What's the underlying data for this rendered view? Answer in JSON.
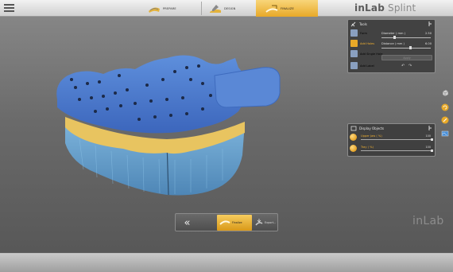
{
  "app": {
    "title_bold": "inLab",
    "title_light": " Splint",
    "watermark": "inLab"
  },
  "steps": [
    {
      "label": "PREPARE",
      "icon": "prepare-icon",
      "active": false
    },
    {
      "label": "DESIGN",
      "icon": "design-icon",
      "active": false
    },
    {
      "label": "FINALIZE",
      "icon": "finalize-icon",
      "active": true
    }
  ],
  "tools": {
    "title": "Tools",
    "items": [
      {
        "label": "Form",
        "icon": "form-icon"
      },
      {
        "label": "Add Holes",
        "icon": "add-holes-icon"
      },
      {
        "label": "Add Single Hole",
        "icon": "add-single-hole-icon"
      },
      {
        "label": "Add Label",
        "icon": "add-label-icon"
      }
    ],
    "params": [
      {
        "label": "Diameter ( mm )",
        "value": "2.50"
      },
      {
        "label": "Distance ( mm )",
        "value": "6.00"
      }
    ],
    "apply_label": "Apply"
  },
  "display_objects": {
    "title": "Display Objects",
    "items": [
      {
        "label": "Upper Jaw ( %)",
        "value": "100"
      },
      {
        "label": "Tray ( %)",
        "value": "100"
      }
    ]
  },
  "bottom_nav": {
    "back_label": "«",
    "finalize_label": "Finalize",
    "export_label": "Export..."
  },
  "colors": {
    "accent": "#e8a928",
    "model_blue": "#4d7cd0",
    "jaw_yellow": "#e8c460",
    "jaw_light_blue": "#7fb6dd"
  }
}
